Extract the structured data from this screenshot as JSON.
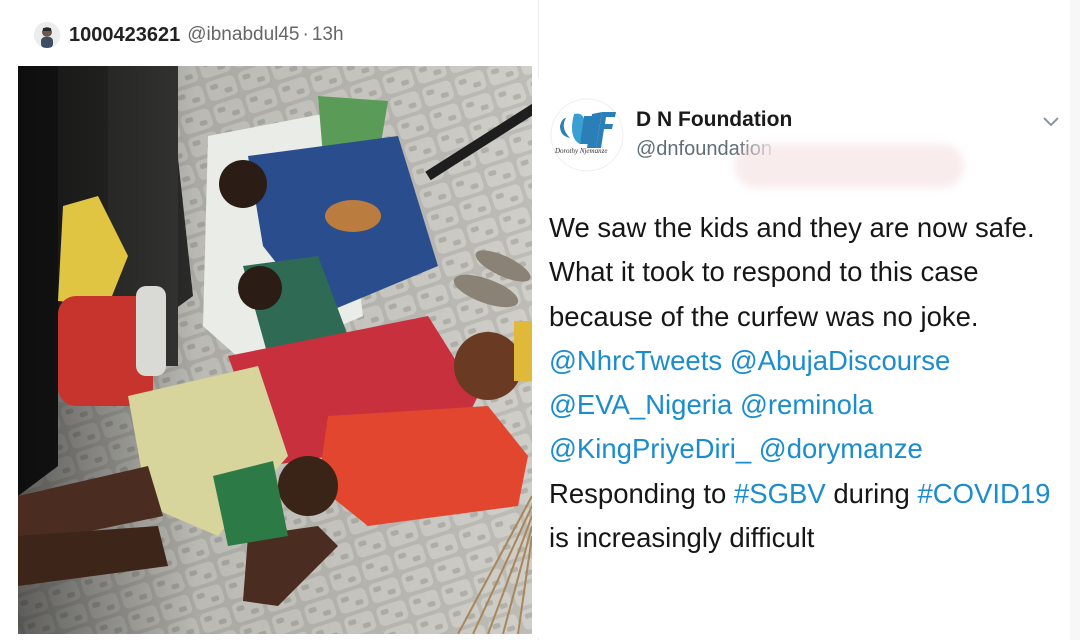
{
  "top_tweet": {
    "display_name": "1000423621",
    "handle": "@ibnabdul45",
    "separator": "·",
    "time": "13h",
    "icons": {
      "avatar": "user-avatar-icon"
    }
  },
  "photo": {
    "icon": "photo-image"
  },
  "reply_tweet": {
    "display_name": "D N Foundation",
    "handle": "@dnfoundation",
    "logo": {
      "text": "DNF",
      "subtext": "Dorothy Njemanze"
    },
    "icons": {
      "menu": "chevron-down-icon",
      "logo": "foundation-logo-icon"
    },
    "text_segments": [
      {
        "text": "We saw the kids and they are now safe. What it took to respond to this case because of the curfew was no joke. ",
        "type": "text"
      },
      {
        "text": "@NhrcTweets",
        "type": "mention"
      },
      {
        "text": " ",
        "type": "text"
      },
      {
        "text": "@AbujaDiscourse",
        "type": "mention"
      },
      {
        "text": " ",
        "type": "text"
      },
      {
        "text": "@EVA_Nigeria",
        "type": "mention"
      },
      {
        "text": " ",
        "type": "text"
      },
      {
        "text": "@reminola",
        "type": "mention"
      },
      {
        "text": " ",
        "type": "text"
      },
      {
        "text": "@KingPriyeDiri_",
        "type": "mention"
      },
      {
        "text": " ",
        "type": "text"
      },
      {
        "text": "@dorymanze",
        "type": "mention"
      },
      {
        "text": " Responding to ",
        "type": "text"
      },
      {
        "text": "#SGBV",
        "type": "hashtag"
      },
      {
        "text": " during ",
        "type": "text"
      },
      {
        "text": "#COVID19",
        "type": "hashtag"
      },
      {
        "text": " is increasingly difficult",
        "type": "text"
      }
    ]
  },
  "colors": {
    "link": "#1b8dcf",
    "text": "#161616",
    "muted": "#5f6e78",
    "logo_blue": "#2b7fb8"
  }
}
